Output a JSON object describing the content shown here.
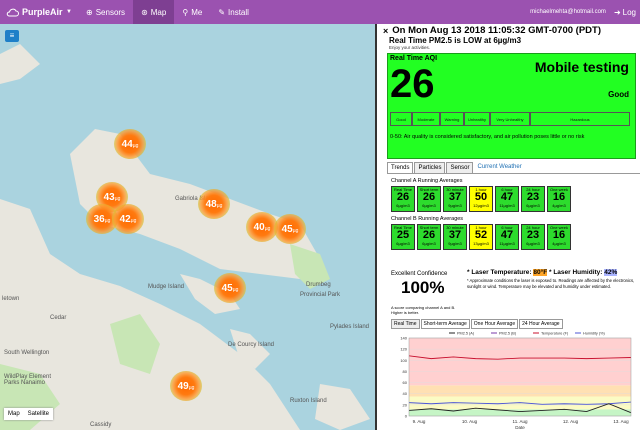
{
  "nav": {
    "brand": "PurpleAir",
    "items": [
      {
        "icon": "globe-icon",
        "label": "Sensors"
      },
      {
        "icon": "map-icon",
        "label": "Map",
        "active": true
      },
      {
        "icon": "person-icon",
        "label": "Me"
      },
      {
        "icon": "wrench-icon",
        "label": "Install"
      }
    ],
    "email": "michaelmehta@hotmail.com",
    "login": "Log"
  },
  "map": {
    "labels": [
      "Gabriola Island",
      "Mudge Island",
      "De Courcy Island",
      "Ruxton Island",
      "Pylades Island",
      "Provincial Park",
      "Drumbeg",
      "Cedar",
      "South Wellington",
      "Cassidy",
      "WildPlay Element Parks Nanaimo",
      "letown"
    ],
    "markers": [
      {
        "value": "44",
        "unit": "µg"
      },
      {
        "value": "43",
        "unit": "µg"
      },
      {
        "value": "36",
        "unit": "µg"
      },
      {
        "value": "42",
        "unit": "µg"
      },
      {
        "value": "48",
        "unit": "µg"
      },
      {
        "value": "40",
        "unit": "µg"
      },
      {
        "value": "45",
        "unit": "µg"
      },
      {
        "value": "45",
        "unit": "µg"
      },
      {
        "value": "49",
        "unit": "µg"
      }
    ],
    "map_type": [
      "Map",
      "Satellite"
    ]
  },
  "panel": {
    "close": "×",
    "title": "On Mon Aug 13 2018 11:05:32 GMT-0700 (PDT)",
    "subtitle": "Real Time PM2.5 is LOW at 6µg/m3",
    "note": "Enjoy your activities.",
    "aqi": {
      "label": "Real Time AQI",
      "value": "26",
      "name": "Mobile testing",
      "category": "Good",
      "scale": [
        {
          "label": "Good",
          "color": "#2ddc2d"
        },
        {
          "label": "Moderate",
          "color": "#ffff00"
        },
        {
          "label": "Warning",
          "color": "#ff9a00"
        },
        {
          "label": "Unhealthy",
          "color": "#ff2a00"
        },
        {
          "label": "Very Unhealthy",
          "color": "#a2004a"
        },
        {
          "label": "Hazardous",
          "color": "#8b0020"
        }
      ],
      "description": "0-50: Air quality is considered satisfactory, and air pollution poses little or no risk"
    },
    "tabs": [
      "Trends",
      "Particles",
      "Sensor",
      "Current Weather"
    ],
    "channel_a": {
      "title": "Channel A Running Averages",
      "cells": [
        {
          "period": "Real Time",
          "value": "26",
          "sub": "6µg/m3",
          "color": "#2ddc2d"
        },
        {
          "period": "Short term",
          "value": "26",
          "sub": "6µg/m3",
          "color": "#2ddc2d"
        },
        {
          "period": "30 minute",
          "value": "37",
          "sub": "9µg/m3",
          "color": "#2ddc2d"
        },
        {
          "period": "1 hour",
          "value": "50",
          "sub": "12µg/m3",
          "color": "#ffff00"
        },
        {
          "period": "6 hour",
          "value": "47",
          "sub": "11µg/m3",
          "color": "#2ddc2d"
        },
        {
          "period": "24 hour",
          "value": "23",
          "sub": "6µg/m3",
          "color": "#2ddc2d"
        },
        {
          "period": "One week",
          "value": "16",
          "sub": "4µg/m3",
          "color": "#2ddc2d"
        }
      ]
    },
    "channel_b": {
      "title": "Channel B Running Averages",
      "cells": [
        {
          "period": "Real Time",
          "value": "25",
          "sub": "6µg/m3",
          "color": "#2ddc2d"
        },
        {
          "period": "Short term",
          "value": "26",
          "sub": "6µg/m3",
          "color": "#2ddc2d"
        },
        {
          "period": "30 minute",
          "value": "37",
          "sub": "9µg/m3",
          "color": "#2ddc2d"
        },
        {
          "period": "1 hour",
          "value": "52",
          "sub": "13µg/m3",
          "color": "#ffff00"
        },
        {
          "period": "6 hour",
          "value": "47",
          "sub": "11µg/m3",
          "color": "#2ddc2d"
        },
        {
          "period": "24 hour",
          "value": "23",
          "sub": "6µg/m3",
          "color": "#2ddc2d"
        },
        {
          "period": "One week",
          "value": "16",
          "sub": "4µg/m3",
          "color": "#2ddc2d"
        }
      ]
    },
    "confidence": {
      "title": "Excellent Confidence",
      "value": "100%",
      "note": "A score comparing channel A and B. Higher is better."
    },
    "laser": {
      "temp_label": "* Laser Temperature:",
      "temp_value": "80°F",
      "hum_label": "* Laser Humidity:",
      "hum_value": "42%",
      "note": "* Approximate conditions the laser is exposed to. Readings are affected by the electronics, sunlight or wind. Temperature may be elevated and humidity under estimated."
    },
    "graph_tabs": [
      "Real Time",
      "Short-term Average",
      "One Hour Average",
      "24 Hour Average"
    ]
  },
  "chart_data": {
    "type": "line",
    "x": [
      "9. Aug",
      "10. Aug",
      "11. Aug",
      "12. Aug",
      "13. Aug"
    ],
    "xlabel": "Date",
    "ylim": [
      0,
      140
    ],
    "yticks": [
      0,
      20,
      40,
      60,
      80,
      100,
      120,
      140
    ],
    "legend": [
      "PM2.5 (A)",
      "PM2.5 (B)",
      "Temperature (F)",
      "Humidity (%)"
    ],
    "series": [
      {
        "name": "Temperature (F)",
        "color": "#c8102e",
        "values": [
          108,
          103,
          106,
          103,
          102,
          104,
          104,
          104,
          103,
          104,
          105
        ]
      },
      {
        "name": "Humidity (%)",
        "color": "#4d57d6",
        "values": [
          24,
          22,
          24,
          23,
          22,
          24,
          21,
          22,
          21,
          22,
          25
        ]
      },
      {
        "name": "PM2.5 (A)",
        "color": "#222",
        "values": [
          10,
          13,
          9,
          14,
          11,
          8,
          10,
          12,
          8,
          22,
          6
        ]
      }
    ]
  }
}
